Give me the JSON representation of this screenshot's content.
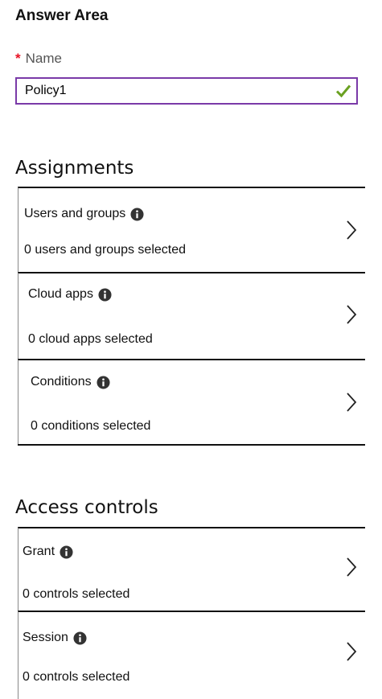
{
  "header": {
    "title": "Answer Area"
  },
  "name_field": {
    "required_marker": "*",
    "label": "Name",
    "value": "Policy1",
    "valid": true
  },
  "assignments": {
    "title": "Assignments",
    "rows": [
      {
        "label": "Users and groups",
        "status": "0 users and groups selected"
      },
      {
        "label": "Cloud apps",
        "status": "0 cloud apps selected"
      },
      {
        "label": "Conditions",
        "status": "0 conditions selected"
      }
    ]
  },
  "access_controls": {
    "title": "Access controls",
    "rows": [
      {
        "label": "Grant",
        "status": "0 controls selected"
      },
      {
        "label": "Session",
        "status": "0 controls selected"
      }
    ]
  },
  "icons": {
    "info": "info-icon",
    "chevron": "chevron-right-icon",
    "check": "check-icon"
  },
  "colors": {
    "input_border": "#7a3aa8",
    "check": "#6aa121",
    "required": "#e81123"
  }
}
